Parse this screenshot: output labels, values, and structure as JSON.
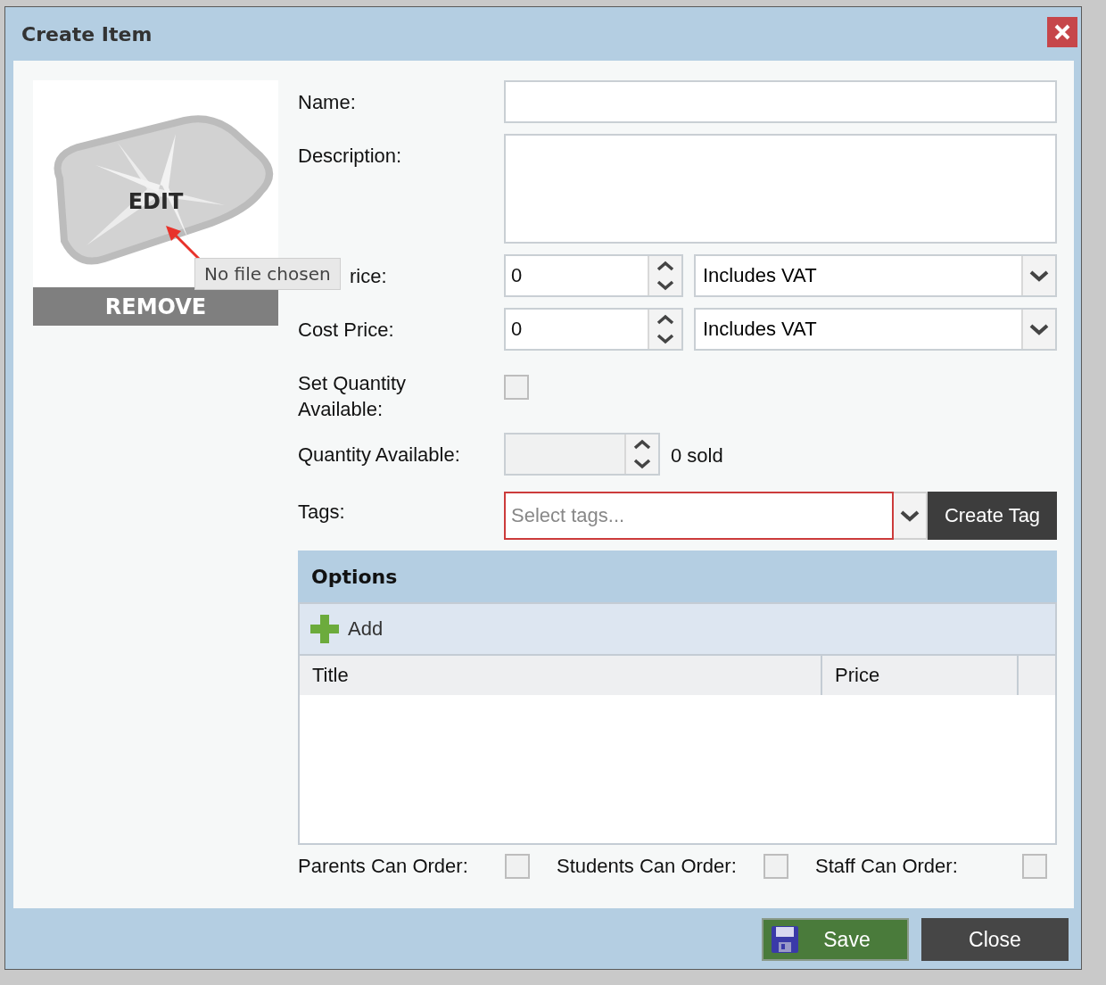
{
  "window": {
    "title": "Create Item"
  },
  "image": {
    "edit_label": "EDIT",
    "remove_label": "REMOVE",
    "tooltip": "No file chosen"
  },
  "form": [
    {
      "kind": "text",
      "label": "Name:"
    },
    {
      "kind": "textarea",
      "label": "Description:"
    },
    {
      "kind": "price",
      "label": "rice:",
      "value": "0",
      "vat": "Includes VAT"
    },
    {
      "kind": "price",
      "label": "Cost Price:",
      "value": "0",
      "vat": "Includes VAT"
    },
    {
      "kind": "checkbox",
      "label": "Set Quantity Available:",
      "checked": false
    },
    {
      "kind": "quantity",
      "label": "Quantity Available:",
      "disabled": true,
      "note": "0 sold"
    },
    {
      "kind": "tags",
      "label": "Tags:",
      "placeholder": "Select tags...",
      "invalid": true,
      "button": "Create Tag"
    }
  ],
  "options": {
    "title": "Options",
    "add_label": "Add",
    "columns": [
      "Title",
      "Price"
    ]
  },
  "permissions": [
    {
      "label": "Parents Can Order:",
      "checked": false
    },
    {
      "label": "Students Can Order:",
      "checked": false
    },
    {
      "label": "Staff Can Order:",
      "checked": false
    }
  ],
  "buttons": [
    {
      "kind": "save",
      "label": "Save"
    },
    {
      "kind": "close",
      "label": "Close"
    }
  ]
}
